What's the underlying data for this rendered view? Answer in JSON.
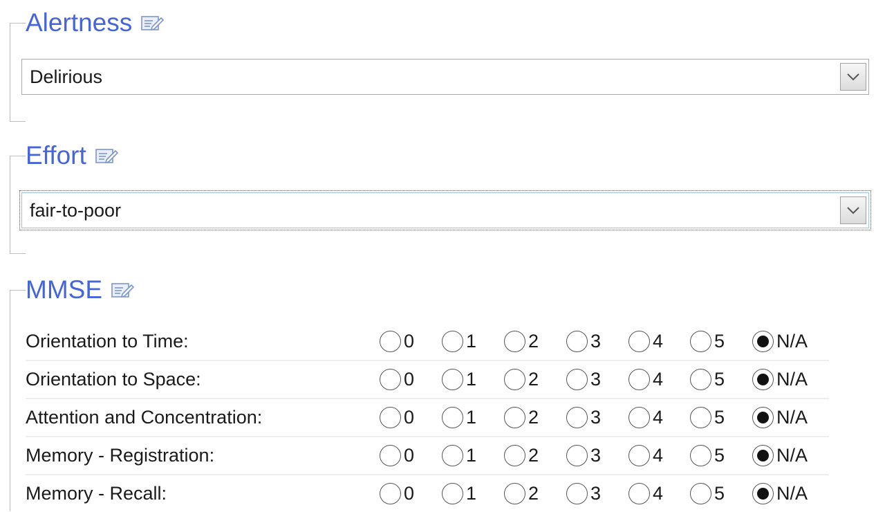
{
  "alertness": {
    "title": "Alertness",
    "edit_icon": "edit-icon",
    "selected_value": "Delirious"
  },
  "effort": {
    "title": "Effort",
    "edit_icon": "edit-icon",
    "selected_value": "fair-to-poor"
  },
  "mmse": {
    "title": "MMSE",
    "edit_icon": "edit-icon",
    "options": [
      "0",
      "1",
      "2",
      "3",
      "4",
      "5",
      "N/A"
    ],
    "rows": [
      {
        "label": "Orientation to Time:",
        "selected": "N/A"
      },
      {
        "label": "Orientation to Space:",
        "selected": "N/A"
      },
      {
        "label": "Attention and Concentration:",
        "selected": "N/A"
      },
      {
        "label": "Memory - Registration:",
        "selected": "N/A"
      },
      {
        "label": "Memory - Recall:",
        "selected": "N/A"
      }
    ]
  },
  "colors": {
    "legend": "#4565d8",
    "border": "#bdbdbd",
    "focus_border": "#9fc4ea"
  }
}
